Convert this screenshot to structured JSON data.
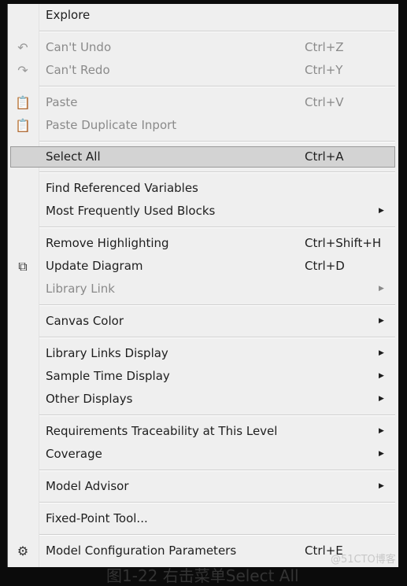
{
  "menu": {
    "groups": [
      [
        {
          "label": "Explore"
        }
      ],
      [
        {
          "label": "Can't Undo",
          "shortcut": "Ctrl+Z",
          "icon": "undo-icon",
          "disabled": true
        },
        {
          "label": "Can't Redo",
          "shortcut": "Ctrl+Y",
          "icon": "redo-icon",
          "disabled": true
        }
      ],
      [
        {
          "label": "Paste",
          "shortcut": "Ctrl+V",
          "icon": "paste-icon",
          "disabled": true
        },
        {
          "label": "Paste Duplicate Inport",
          "icon": "paste-icon",
          "disabled": true
        }
      ],
      [
        {
          "label": "Select All",
          "shortcut": "Ctrl+A",
          "selected": true
        }
      ],
      [
        {
          "label": "Find Referenced Variables"
        },
        {
          "label": "Most Frequently Used Blocks",
          "submenu": true
        }
      ],
      [
        {
          "label": "Remove Highlighting",
          "shortcut": "Ctrl+Shift+H"
        },
        {
          "label": "Update Diagram",
          "shortcut": "Ctrl+D",
          "icon": "update-diagram-icon"
        },
        {
          "label": "Library Link",
          "submenu": true,
          "disabled": true
        }
      ],
      [
        {
          "label": "Canvas Color",
          "submenu": true
        }
      ],
      [
        {
          "label": "Library Links Display",
          "submenu": true
        },
        {
          "label": "Sample Time Display",
          "submenu": true
        },
        {
          "label": "Other Displays",
          "submenu": true
        }
      ],
      [
        {
          "label": "Requirements Traceability at This Level",
          "submenu": true
        },
        {
          "label": "Coverage",
          "submenu": true
        }
      ],
      [
        {
          "label": "Model Advisor",
          "submenu": true
        }
      ],
      [
        {
          "label": "Fixed-Point Tool..."
        }
      ],
      [
        {
          "label": "Model Configuration Parameters",
          "shortcut": "Ctrl+E",
          "icon": "gear-icon"
        }
      ]
    ]
  },
  "watermark": "@51CTO博客",
  "caption": "图1-22 右击菜单Select All"
}
